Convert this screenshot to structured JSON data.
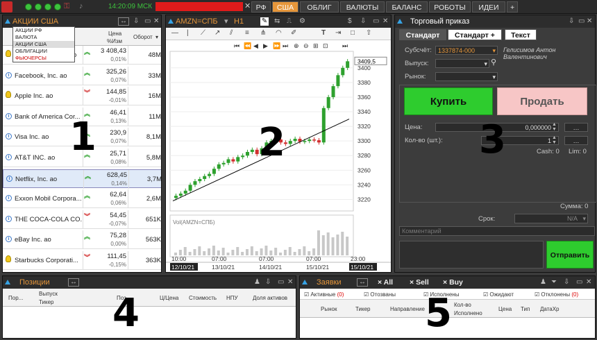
{
  "topbar": {
    "clock": "14:20:09 МСК",
    "tabs": [
      "РФ",
      "США",
      "ОБЛИГ",
      "ВАЛЮТЫ",
      "БАЛАНС",
      "РОБОТЫ",
      "ИДЕИ",
      "+"
    ],
    "active_tab": "США"
  },
  "watchlist": {
    "title": "АКЦИИ США",
    "dropdown_options": [
      "АКЦИИ РФ",
      "ВАЛЮТА",
      "АКЦИИ США",
      "ОБЛИГАЦИИ",
      "ФЬЮЧЕРСЫ"
    ],
    "col_price": "Цена",
    "col_change": "%Изм",
    "col_volume": "Оборот",
    "rows": [
      {
        "name": "Amazon.com, Inc. ao",
        "price": "3 408,43",
        "change": "0,01%",
        "volume": "48M",
        "dir": "up",
        "icon": "bulb"
      },
      {
        "name": "Facebook, Inc. ao",
        "price": "325,26",
        "change": "0,07%",
        "volume": "33M",
        "dir": "up",
        "icon": "info"
      },
      {
        "name": "Apple Inc. ao",
        "price": "144,85",
        "change": "-0,01%",
        "volume": "16M",
        "dir": "down",
        "icon": "bulb"
      },
      {
        "name": "Bank of America Cor...",
        "price": "46,41",
        "change": "0,13%",
        "volume": "11M",
        "dir": "up",
        "icon": "info"
      },
      {
        "name": "Visa Inc. ao",
        "price": "230,9",
        "change": "0,07%",
        "volume": "8,1M",
        "dir": "up",
        "icon": "info"
      },
      {
        "name": "AT&T INC. ao",
        "price": "25,71",
        "change": "0,08%",
        "volume": "5,8M",
        "dir": "up",
        "icon": "info"
      },
      {
        "name": "Netflix, Inc. ao",
        "price": "628,45",
        "change": "0,14%",
        "volume": "3,7M",
        "dir": "up",
        "icon": "info"
      },
      {
        "name": "Exxon Mobil Corpora...",
        "price": "62,64",
        "change": "0,06%",
        "volume": "2,6M",
        "dir": "up",
        "icon": "info"
      },
      {
        "name": "THE COCA-COLA CO...",
        "price": "54,45",
        "change": "-0,07%",
        "volume": "651K",
        "dir": "down",
        "icon": "info"
      },
      {
        "name": "eBay Inc. ao",
        "price": "75,28",
        "change": "0,00%",
        "volume": "563K",
        "dir": "up",
        "icon": "info"
      },
      {
        "name": "Starbucks Corporati...",
        "price": "111,45",
        "change": "-0,15%",
        "volume": "363K",
        "dir": "down",
        "icon": "bulb"
      }
    ]
  },
  "chart": {
    "symbol": "AMZN=СПБ",
    "timeframe": "H1",
    "volume_label": "Vol(AMZN=СПБ)",
    "last_price_label": "3409,5"
  },
  "chart_data": {
    "type": "candlestick",
    "y_ticks": [
      "3400",
      "3380",
      "3360",
      "3340",
      "3320",
      "3300",
      "3280",
      "3260",
      "3240",
      "3220"
    ],
    "x_labels": [
      "12/10/21",
      "13/10/21",
      "14/10/21",
      "15/10/21",
      "15/10/21"
    ],
    "x_time_labels": [
      "10:00",
      "07:00",
      "07:00",
      "07:00",
      "23:00"
    ],
    "ylim": [
      3210,
      3415
    ],
    "close_values": [
      3225,
      3228,
      3232,
      3240,
      3245,
      3248,
      3252,
      3255,
      3262,
      3268,
      3270,
      3275,
      3272,
      3278,
      3280,
      3285,
      3288,
      3282,
      3290,
      3298,
      3300,
      3302,
      3298,
      3296,
      3300,
      3303,
      3299,
      3300,
      3302,
      3301,
      3298,
      3345,
      3360,
      3375,
      3390,
      3400,
      3409
    ]
  },
  "order": {
    "title": "Торговый приказ",
    "tabs": [
      "Стандарт",
      "Стандарт +",
      "Текст"
    ],
    "account_label": "Субсчёт:",
    "account_value": "1337874-000",
    "account_owner": "Гелисимов Антон Валентинович",
    "issue_label": "Выпуск:",
    "market_label": "Рынок:",
    "buy_label": "Купить",
    "sell_label": "Продать",
    "price_label": "Цена:",
    "price_value": "0,000000",
    "qty_label": "Кол-во (шт.):",
    "qty_value": "1",
    "cash_label": "Cash: 0",
    "lim_label": "Lim: 0",
    "sum_label": "Сумма: 0",
    "term_label": "Срок:",
    "term_value": "N/A",
    "comment_placeholder": "Комментарий",
    "send_label": "Отправить",
    "colors": {
      "buy": "#2ecc2e",
      "sell": "#f7c6c6",
      "send": "#2ecc2e"
    }
  },
  "positions": {
    "title": "Позиции",
    "columns": [
      "Пор...",
      "Выпуск",
      "Тикер",
      "Поз",
      "Ц/Цена",
      "Стоимость",
      "НПУ",
      "Доля активов"
    ]
  },
  "orders": {
    "title": "Заявки",
    "actions": [
      "All",
      "Sell",
      "Buy"
    ],
    "filters": [
      "Активные",
      "Отозваны",
      "Исполнены",
      "Ожидают",
      "Отклонены"
    ],
    "active_count": "(0)",
    "rejected_count": "(0)",
    "columns": [
      "Рынок",
      "Тикер",
      "Направление",
      "Кол-во",
      "Исполнено",
      "Цена",
      "Тип",
      "ДатаХр"
    ]
  },
  "overlay_numbers": [
    "1",
    "2",
    "3",
    "4",
    "5"
  ]
}
